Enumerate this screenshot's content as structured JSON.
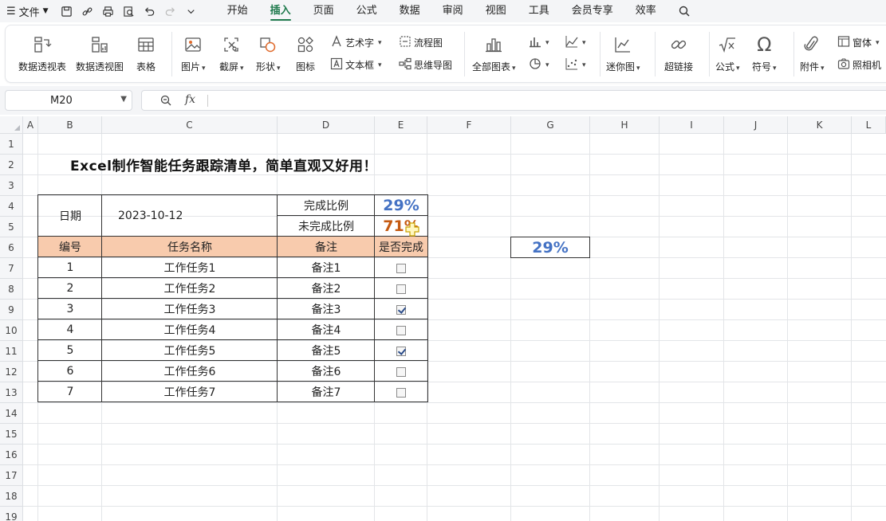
{
  "menubar": {
    "file_label": "文件",
    "tabs": [
      "开始",
      "插入",
      "页面",
      "公式",
      "数据",
      "审阅",
      "视图",
      "工具",
      "会员专享",
      "效率"
    ],
    "active_tab": "插入"
  },
  "ribbon": {
    "pivot_table": "数据透视表",
    "pivot_chart": "数据透视图",
    "table": "表格",
    "picture": "图片",
    "screenshot": "截屏",
    "shapes": "形状",
    "icons": "图标",
    "wordart": "艺术字",
    "flowchart": "流程图",
    "textbox": "文本框",
    "mindmap": "思维导图",
    "all_charts": "全部图表",
    "sparkline": "迷你图",
    "hyperlink": "超链接",
    "formula": "公式",
    "symbol": "符号",
    "attachment": "附件",
    "window": "窗体",
    "camera": "照相机"
  },
  "formula_bar": {
    "name_box": "M20",
    "fx_label": "fx",
    "formula": ""
  },
  "sheet": {
    "columns": [
      "A",
      "B",
      "C",
      "D",
      "E",
      "F",
      "G",
      "H",
      "I",
      "J",
      "K",
      "L"
    ],
    "rows": [
      "1",
      "2",
      "3",
      "4",
      "5",
      "6",
      "7",
      "8",
      "9",
      "10",
      "11",
      "12",
      "13",
      "14",
      "15",
      "16",
      "17",
      "18",
      "19"
    ],
    "title": "Excel制作智能任务跟踪清单，简单直观又好用！",
    "date_label": "日期",
    "date_value": "2023-10-12",
    "done_label": "完成比例",
    "done_value": "29%",
    "undone_label": "未完成比例",
    "undone_value": "71%",
    "headers": {
      "no": "编号",
      "name": "任务名称",
      "note": "备注",
      "done": "是否完成"
    },
    "tasks": [
      {
        "no": "1",
        "name": "工作任务1",
        "note": "备注1",
        "checked": false
      },
      {
        "no": "2",
        "name": "工作任务2",
        "note": "备注2",
        "checked": false
      },
      {
        "no": "3",
        "name": "工作任务3",
        "note": "备注3",
        "checked": true
      },
      {
        "no": "4",
        "name": "工作任务4",
        "note": "备注4",
        "checked": false
      },
      {
        "no": "5",
        "name": "工作任务5",
        "note": "备注5",
        "checked": true
      },
      {
        "no": "6",
        "name": "工作任务6",
        "note": "备注6",
        "checked": false
      },
      {
        "no": "7",
        "name": "工作任务7",
        "note": "备注7",
        "checked": false
      }
    ],
    "g6_value": "29%"
  },
  "colors": {
    "accent_green": "#1f7a4d",
    "header_fill": "#f8cbad",
    "percent_blue": "#4472c4",
    "percent_orange": "#c55a11"
  }
}
